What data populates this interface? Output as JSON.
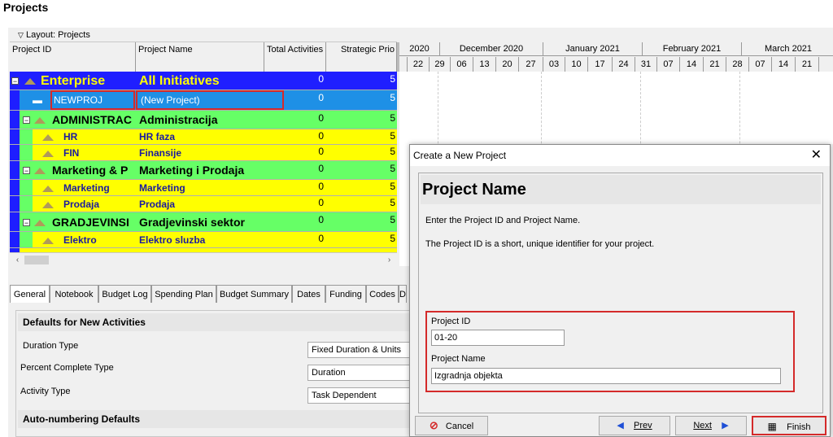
{
  "window": {
    "title": "Projects"
  },
  "layout": {
    "label": "Layout: Projects"
  },
  "columns": [
    "Project ID",
    "Project Name",
    "Total Activities",
    "Strategic Prio"
  ],
  "rows": [
    {
      "id": "Enterprise",
      "name": "All Initiatives",
      "activities": "0",
      "prio": "5",
      "level": "enterprise"
    },
    {
      "id": "NEWPROJ",
      "name": "(New Project)",
      "activities": "0",
      "prio": "5",
      "level": "selected"
    },
    {
      "id": "ADMINISTRAC",
      "name": "Administracija",
      "activities": "0",
      "prio": "5",
      "level": "group"
    },
    {
      "id": "HR",
      "name": "HR faza",
      "activities": "0",
      "prio": "5",
      "level": "child"
    },
    {
      "id": "FIN",
      "name": "Finansije",
      "activities": "0",
      "prio": "5",
      "level": "child"
    },
    {
      "id": "Marketing & P",
      "name": "Marketing i Prodaja",
      "activities": "0",
      "prio": "5",
      "level": "group"
    },
    {
      "id": "Marketing",
      "name": "Marketing",
      "activities": "0",
      "prio": "5",
      "level": "child"
    },
    {
      "id": "Prodaja",
      "name": "Prodaja",
      "activities": "0",
      "prio": "5",
      "level": "child"
    },
    {
      "id": "GRADJEVINSI",
      "name": "Gradjevinski sektor",
      "activities": "0",
      "prio": "5",
      "level": "group"
    },
    {
      "id": "Elektro",
      "name": "Elektro sluzba",
      "activities": "0",
      "prio": "5",
      "level": "child"
    }
  ],
  "gantt": {
    "months": [
      "2020",
      "December 2020",
      "January 2021",
      "February 2021",
      "March 2021"
    ],
    "weeks": [
      "22",
      "29",
      "06",
      "13",
      "20",
      "27",
      "03",
      "10",
      "17",
      "24",
      "31",
      "07",
      "14",
      "21",
      "28",
      "07",
      "14",
      "21"
    ]
  },
  "tabs": [
    "General",
    "Notebook",
    "Budget Log",
    "Spending Plan",
    "Budget Summary",
    "Dates",
    "Funding",
    "Codes",
    "D"
  ],
  "details": {
    "section1": "Defaults for New Activities",
    "fields": [
      {
        "label": "Duration Type",
        "value": "Fixed Duration & Units"
      },
      {
        "label": "Percent Complete Type",
        "value": "Duration"
      },
      {
        "label": "Activity Type",
        "value": "Task Dependent"
      }
    ],
    "section2": "Auto-numbering Defaults"
  },
  "dialog": {
    "title": "Create a New Project",
    "heading": "Project Name",
    "text1": "Enter the Project ID and Project Name.",
    "text2": "The Project ID is a short, unique identifier for your project.",
    "id_label": "Project ID",
    "id_value": "01-20",
    "name_label": "Project Name",
    "name_value": "Izgradnja objekta",
    "cancel": "Cancel",
    "prev": "Prev",
    "next": "Next",
    "finish": "Finish"
  },
  "colors": {
    "enterprise": "#1f1fff",
    "group": "#66ff66",
    "child": "#ffff00",
    "selected": "#1e90e6",
    "highlight": "#d42a2a"
  }
}
